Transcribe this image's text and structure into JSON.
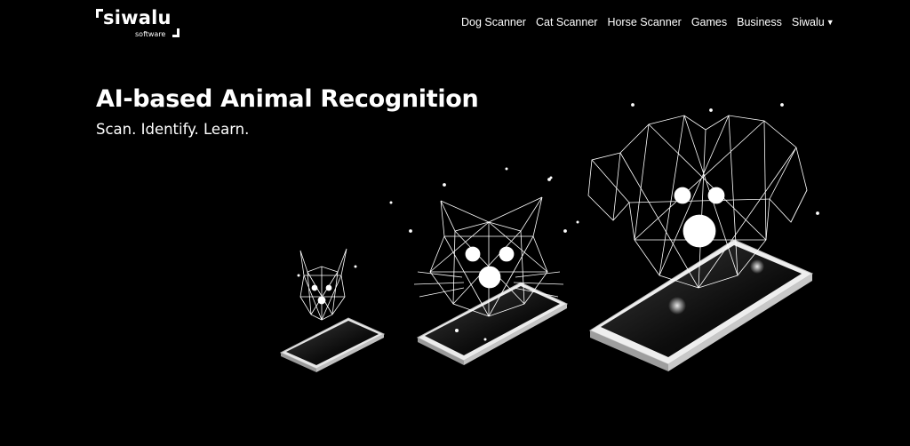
{
  "brand": {
    "name": "siwalu",
    "tagline": "software"
  },
  "nav": {
    "items": [
      {
        "label": "Dog Scanner"
      },
      {
        "label": "Cat Scanner"
      },
      {
        "label": "Horse Scanner"
      },
      {
        "label": "Games"
      },
      {
        "label": "Business"
      },
      {
        "label": "Siwalu",
        "dropdown": true
      }
    ]
  },
  "hero": {
    "title": "AI-based Animal Recognition",
    "subtitle": "Scan. Identify. Learn."
  },
  "illustration": {
    "subjects": [
      "cat-small",
      "cat",
      "dog"
    ],
    "colors": {
      "line": "#ffffff",
      "phone_body": "#e6e6e6",
      "screen": "#1a1a1a",
      "background": "#000000"
    }
  }
}
